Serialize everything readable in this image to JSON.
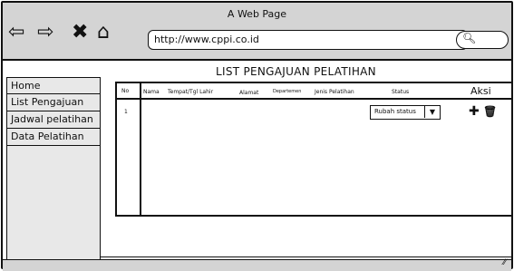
{
  "window": {
    "title": "A Web Page",
    "url": "http://www.cppi.co.id"
  },
  "nav_icons": [
    "back-arrow-icon",
    "forward-arrow-icon",
    "close-icon",
    "home-icon"
  ],
  "sidebar": {
    "items": [
      {
        "label": "Home"
      },
      {
        "label": "List Pengajuan"
      },
      {
        "label": "Jadwal pelatihan"
      },
      {
        "label": "Data Pelatihan"
      }
    ]
  },
  "page": {
    "title": "LIST PENGAJUAN PELATIHAN"
  },
  "table": {
    "headers": [
      "No",
      "Nama",
      "Tempat/Tgl Lahir",
      "Alamat",
      "Departemen",
      "Jenis Pelatihan",
      "Status",
      "Aksi"
    ],
    "rows": [
      {
        "no": "1",
        "status": "Rubah status"
      }
    ]
  }
}
